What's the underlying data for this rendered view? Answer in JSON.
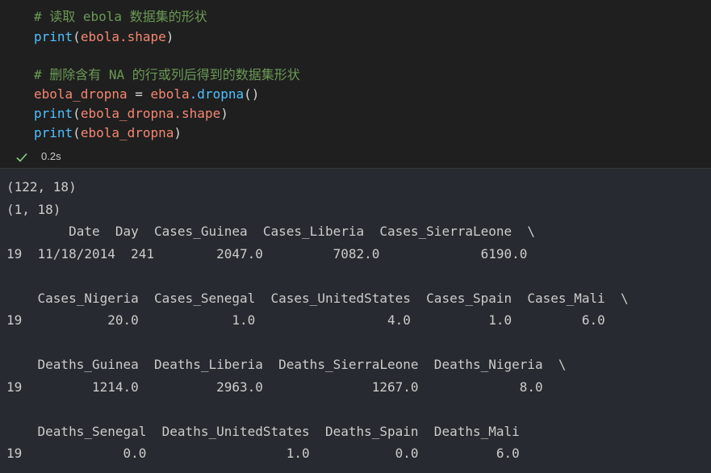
{
  "code": {
    "comment1": "# 读取 ebola 数据集的形状",
    "line2_fn": "print",
    "line2_var": "ebola",
    "line2_attr": ".shape",
    "comment2": "# 删除含有 NA 的行或列后得到的数据集形状",
    "line5_var": "ebola_dropna",
    "line5_op": " = ",
    "line5_obj": "ebola",
    "line5_method": ".dropna",
    "line5_tail": "()",
    "line6_fn": "print",
    "line6_var": "ebola_dropna",
    "line6_attr": ".shape",
    "line7_fn": "print",
    "line7_var": "ebola_dropna"
  },
  "status": {
    "check_icon": "check-icon",
    "exec_time": "0.2s"
  },
  "output": {
    "lines": [
      "(122, 18)",
      "(1, 18)",
      "        Date  Day  Cases_Guinea  Cases_Liberia  Cases_SierraLeone  \\",
      "19  11/18/2014  241        2047.0         7082.0             6190.0",
      "",
      "    Cases_Nigeria  Cases_Senegal  Cases_UnitedStates  Cases_Spain  Cases_Mali  \\",
      "19           20.0            1.0                 4.0          1.0         6.0",
      "",
      "    Deaths_Guinea  Deaths_Liberia  Deaths_SierraLeone  Deaths_Nigeria  \\",
      "19         1214.0          2963.0              1267.0             8.0",
      "",
      "    Deaths_Senegal  Deaths_UnitedStates  Deaths_Spain  Deaths_Mali",
      "19             0.0                  1.0           0.0          6.0"
    ]
  },
  "colors": {
    "background": "#1f1f1f",
    "output_background": "#272a30",
    "comment": "#6a9955",
    "function": "#4fc1ff",
    "variable": "#f48771",
    "check": "#89d185"
  }
}
